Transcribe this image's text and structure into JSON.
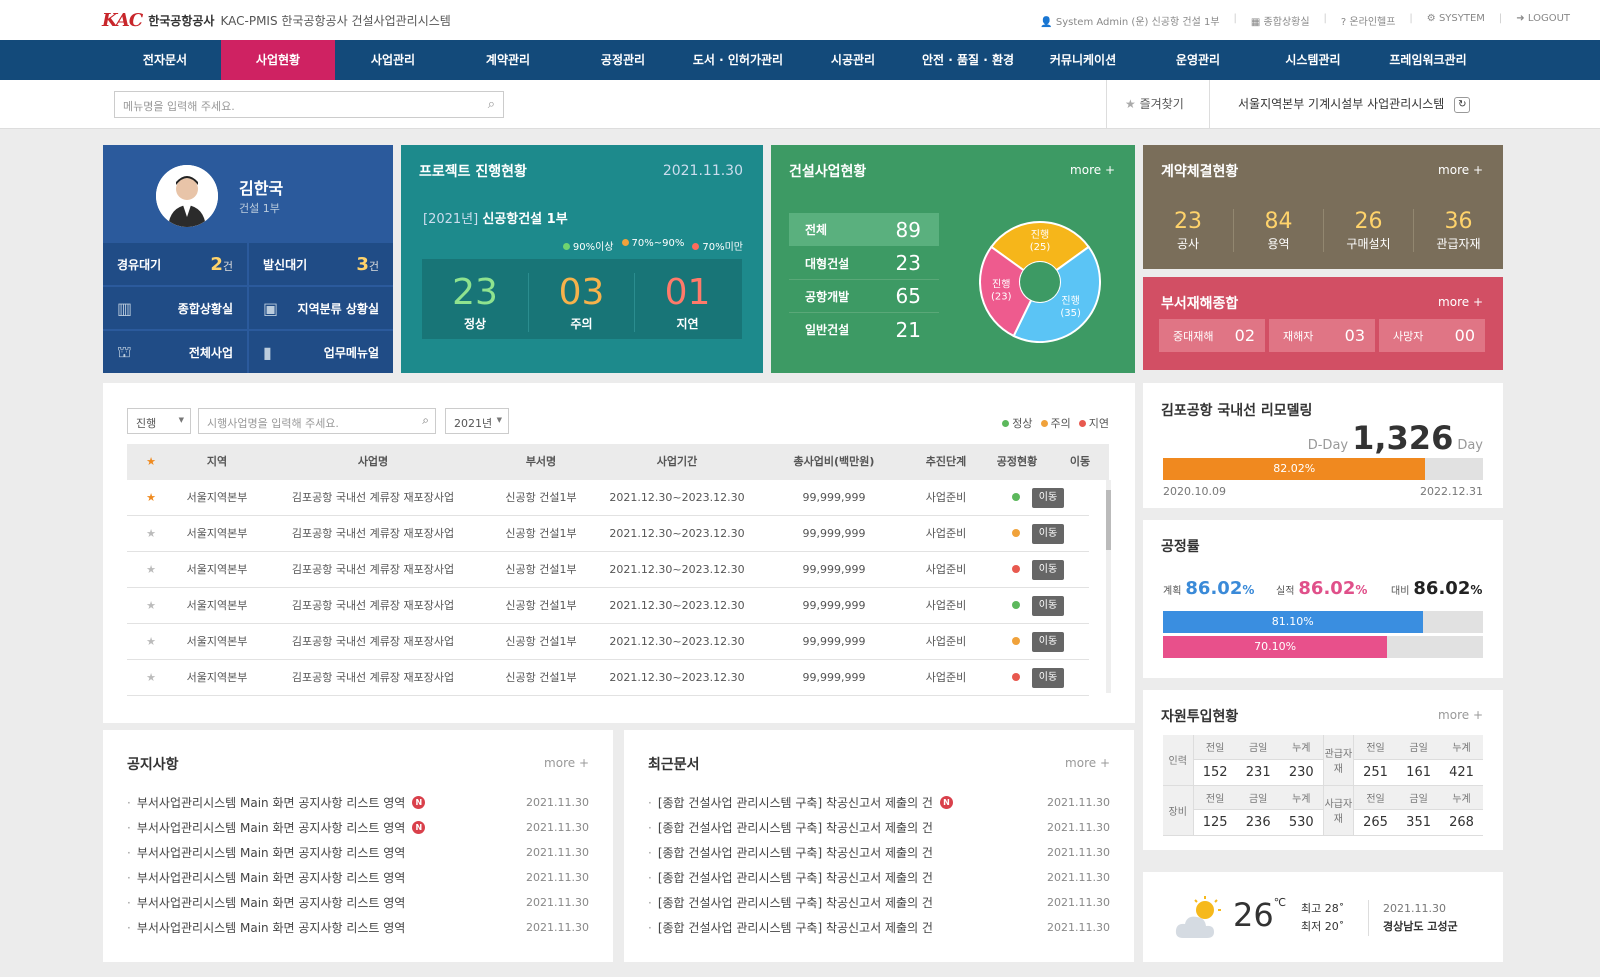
{
  "header": {
    "logo_mark": "KAC",
    "company": "한국공항공사",
    "system_name": "KAC-PMIS 한국공항공사 건설사업관리시스템",
    "utils": [
      "System Admin (운) 신공항 건설 1부",
      "종합상황실",
      "온라인헬프",
      "SYSYTEM",
      "LOGOUT"
    ]
  },
  "gnb": [
    "전자문서",
    "사업현황",
    "사업관리",
    "계약관리",
    "공정관리",
    "도서 · 인허가관리",
    "시공관리",
    "안전 · 품질 · 환경",
    "커뮤니케이션",
    "운영관리",
    "시스템관리",
    "프레임워크관리"
  ],
  "gnb_active": 1,
  "subbar": {
    "search_placeholder": "메뉴명을 입력해 주세요.",
    "favorites": "즐겨찾기",
    "current_system": "서울지역본부 기계시설부 사업관리시스템"
  },
  "profile": {
    "name": "김한국",
    "dept": "건설 1부",
    "pending": {
      "label": "경유대기",
      "count": "2",
      "unit": "건"
    },
    "sent": {
      "label": "발신대기",
      "count": "3",
      "unit": "건"
    },
    "links": [
      "종합상황실",
      "지역분류 상황실",
      "전체사업",
      "업무메뉴얼"
    ]
  },
  "project": {
    "title": "프로젝트 진행현황",
    "date": "2021.11.30",
    "year": "[2021년]",
    "name": "신공항건설 1부",
    "legend": [
      "90%이상",
      "70%~90%",
      "70%미만"
    ],
    "stats": [
      {
        "num": "23",
        "label": "정상"
      },
      {
        "num": "03",
        "label": "주의"
      },
      {
        "num": "01",
        "label": "지연"
      }
    ]
  },
  "construction": {
    "title": "건설사업현황",
    "more": "more +",
    "rows": [
      {
        "label": "전체",
        "value": "89"
      },
      {
        "label": "대형건설",
        "value": "23"
      },
      {
        "label": "공항개발",
        "value": "65"
      },
      {
        "label": "일반건설",
        "value": "21"
      }
    ],
    "chart_data": {
      "type": "pie",
      "slices": [
        {
          "label": "진행 (25)",
          "value": 25
        },
        {
          "label": "진행 (35)",
          "value": 35
        },
        {
          "label": "진행 (23)",
          "value": 23
        }
      ]
    }
  },
  "contract": {
    "title": "계약체결현황",
    "more": "more +",
    "items": [
      {
        "num": "23",
        "label": "공사"
      },
      {
        "num": "84",
        "label": "용역"
      },
      {
        "num": "26",
        "label": "구매설치"
      },
      {
        "num": "36",
        "label": "관급자재"
      }
    ]
  },
  "disaster": {
    "title": "부서재해종합",
    "more": "more +",
    "items": [
      {
        "label": "중대재해",
        "value": "02"
      },
      {
        "label": "재해자",
        "value": "03"
      },
      {
        "label": "사망자",
        "value": "00"
      }
    ]
  },
  "table": {
    "filter_status": "진행",
    "filter_search_placeholder": "시행사업명을 입력해 주세요.",
    "filter_year": "2021년",
    "legend": [
      "정상",
      "주의",
      "지연"
    ],
    "columns": [
      "★",
      "지역",
      "사업명",
      "부서명",
      "사업기간",
      "총사업비(백만원)",
      "추진단계",
      "공정현황",
      "이동"
    ],
    "rows": [
      {
        "region": "서울지역본부",
        "name": "김포공항 국내선 계류장 재포장사업",
        "dept": "신공항 건설1부",
        "period": "2021.12.30~2023.12.30",
        "cost": "99,999,999",
        "stage": "사업준비",
        "move": "이동"
      },
      {
        "region": "서울지역본부",
        "name": "김포공항 국내선 계류장 재포장사업",
        "dept": "신공항 건설1부",
        "period": "2021.12.30~2023.12.30",
        "cost": "99,999,999",
        "stage": "사업준비",
        "move": "이동"
      },
      {
        "region": "서울지역본부",
        "name": "김포공항 국내선 계류장 재포장사업",
        "dept": "신공항 건설1부",
        "period": "2021.12.30~2023.12.30",
        "cost": "99,999,999",
        "stage": "사업준비",
        "move": "이동"
      },
      {
        "region": "서울지역본부",
        "name": "김포공항 국내선 계류장 재포장사업",
        "dept": "신공항 건설1부",
        "period": "2021.12.30~2023.12.30",
        "cost": "99,999,999",
        "stage": "사업준비",
        "move": "이동"
      },
      {
        "region": "서울지역본부",
        "name": "김포공항 국내선 계류장 재포장사업",
        "dept": "신공항 건설1부",
        "period": "2021.12.30~2023.12.30",
        "cost": "99,999,999",
        "stage": "사업준비",
        "move": "이동"
      },
      {
        "region": "서울지역본부",
        "name": "김포공항 국내선 계류장 재포장사업",
        "dept": "신공항 건설1부",
        "period": "2021.12.30~2023.12.30",
        "cost": "99,999,999",
        "stage": "사업준비",
        "move": "이동"
      }
    ],
    "row_status": [
      "green",
      "orange",
      "red",
      "green",
      "orange",
      "red"
    ],
    "row_starred": [
      true,
      false,
      false,
      false,
      false,
      false
    ]
  },
  "notices": {
    "title": "공지사항",
    "more": "more +",
    "items": [
      {
        "text": "부서사업관리시스템 Main 화면 공지사항 리스트 영역",
        "date": "2021.11.30",
        "new": "N"
      },
      {
        "text": "부서사업관리시스템 Main 화면 공지사항 리스트 영역",
        "date": "2021.11.30",
        "new": "N"
      },
      {
        "text": "부서사업관리시스템 Main 화면 공지사항 리스트 영역",
        "date": "2021.11.30"
      },
      {
        "text": "부서사업관리시스템 Main 화면 공지사항 리스트 영역",
        "date": "2021.11.30"
      },
      {
        "text": "부서사업관리시스템 Main 화면 공지사항 리스트 영역",
        "date": "2021.11.30"
      },
      {
        "text": "부서사업관리시스템 Main 화면 공지사항 리스트 영역",
        "date": "2021.11.30"
      }
    ]
  },
  "recent": {
    "title": "최근문서",
    "more": "more +",
    "items": [
      {
        "text": "[종합 건설사업 관리시스템 구축] 착공신고서 제출의 건",
        "date": "2021.11.30",
        "new": "N"
      },
      {
        "text": "[종합 건설사업 관리시스템 구축] 착공신고서 제출의 건",
        "date": "2021.11.30"
      },
      {
        "text": "[종합 건설사업 관리시스템 구축] 착공신고서 제출의 건",
        "date": "2021.11.30"
      },
      {
        "text": "[종합 건설사업 관리시스템 구축] 착공신고서 제출의 건",
        "date": "2021.11.30"
      },
      {
        "text": "[종합 건설사업 관리시스템 구축] 착공신고서 제출의 건",
        "date": "2021.11.30"
      },
      {
        "text": "[종합 건설사업 관리시스템 구축] 착공신고서 제출의 건",
        "date": "2021.11.30"
      }
    ]
  },
  "dday": {
    "title": "김포공항 국내선 리모델링",
    "prefix": "D-Day",
    "days": "1,326",
    "suffix": "Day",
    "progress": "82.02%",
    "progress_value": 82.02,
    "start": "2020.10.09",
    "end": "2022.12.31"
  },
  "rate": {
    "title": "공정률",
    "plan_label": "계획",
    "plan": "86.02",
    "actual_label": "실적",
    "actual": "86.02",
    "ratio_label": "대비",
    "ratio": "86.02",
    "pct": "%",
    "bar1": "81.10%",
    "bar1_value": 81.1,
    "bar2": "70.10%",
    "bar2_value": 70.1
  },
  "resources": {
    "title": "자원투입현황",
    "more": "more +",
    "heads": [
      "전일",
      "금일",
      "누계"
    ],
    "labor": {
      "label": "인력",
      "values": [
        "152",
        "231",
        "230"
      ]
    },
    "gov": {
      "label": "관급자재",
      "values": [
        "251",
        "161",
        "421"
      ]
    },
    "equip": {
      "label": "장비",
      "values": [
        "125",
        "236",
        "530"
      ]
    },
    "private": {
      "label": "사급자재",
      "values": [
        "265",
        "351",
        "268"
      ]
    }
  },
  "weather": {
    "temp": "26",
    "unit": "℃",
    "high": "최고 28˚",
    "low": "최저 20˚",
    "date": "2021.11.30",
    "location": "경상남도 고성군"
  },
  "colors": {
    "green": "#5cb85c",
    "orange": "#f0a23b",
    "red": "#e8594f",
    "navy": "#134a7a",
    "pink": "#cf2262"
  }
}
